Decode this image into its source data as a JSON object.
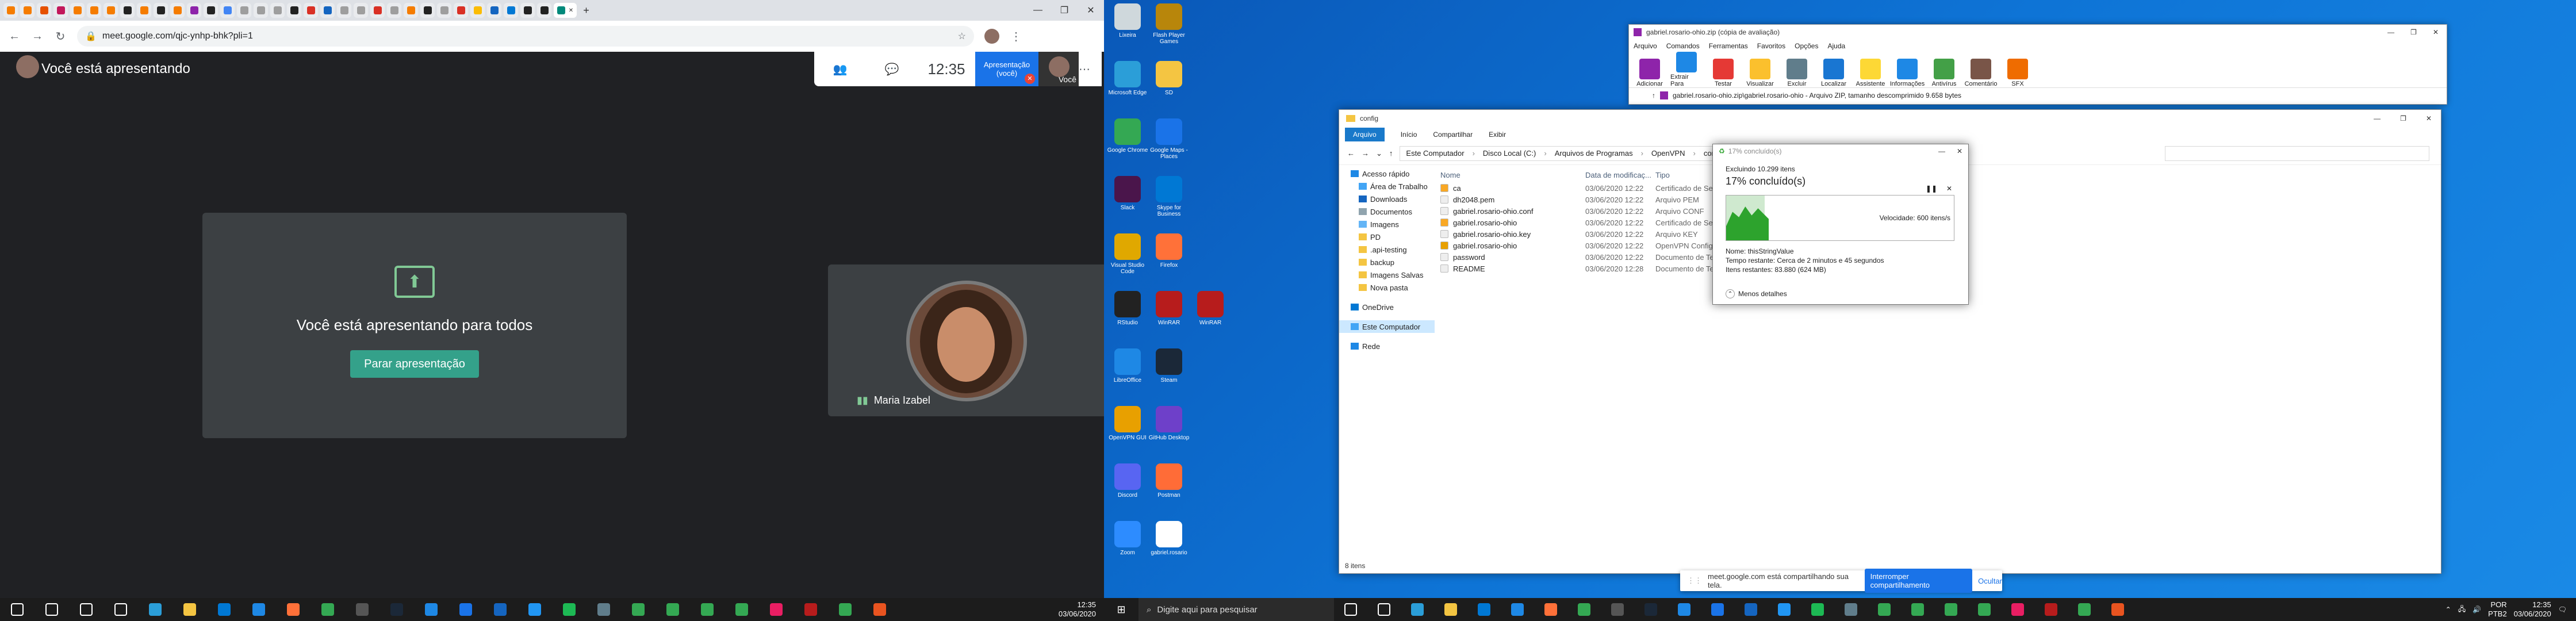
{
  "left": {
    "chrome": {
      "url": "meet.google.com/qjc-ynhp-bhk?pli=1",
      "tabs": [
        {
          "icon": "orange-circle-icon",
          "color": "#f57c00"
        },
        {
          "icon": "orange-circle-icon",
          "color": "#f57c00"
        },
        {
          "icon": "orange-circle-icon",
          "color": "#e65100"
        },
        {
          "icon": "linkedin-icon",
          "color": "#c2185b"
        },
        {
          "icon": "orange-circle-icon",
          "color": "#f57c00"
        },
        {
          "icon": "orange-circle-icon",
          "color": "#f57c00"
        },
        {
          "icon": "orange-circle-icon",
          "color": "#f57c00"
        },
        {
          "icon": "github-icon",
          "color": "#222222"
        },
        {
          "icon": "orange-circle-icon",
          "color": "#f57c00"
        },
        {
          "icon": "github-icon",
          "color": "#222222"
        },
        {
          "icon": "orange-circle-icon",
          "color": "#f57c00"
        },
        {
          "icon": "kanban-icon",
          "color": "#8e24aa"
        },
        {
          "icon": "github-icon",
          "color": "#222222"
        },
        {
          "icon": "google-icon",
          "color": "#4285f4"
        },
        {
          "icon": "page-icon",
          "color": "#9e9e9e"
        },
        {
          "icon": "page-icon",
          "color": "#9e9e9e"
        },
        {
          "icon": "page-icon",
          "color": "#9e9e9e"
        },
        {
          "icon": "github-icon",
          "color": "#222222"
        },
        {
          "icon": "gmail-icon",
          "color": "#d93025"
        },
        {
          "icon": "word-icon",
          "color": "#1565c0"
        },
        {
          "icon": "page-icon",
          "color": "#9e9e9e"
        },
        {
          "icon": "page-icon",
          "color": "#9e9e9e"
        },
        {
          "icon": "gmail-icon",
          "color": "#d93025"
        },
        {
          "icon": "page-icon",
          "color": "#9e9e9e"
        },
        {
          "icon": "orange-circle-icon",
          "color": "#f57c00"
        },
        {
          "icon": "github-icon",
          "color": "#222222"
        },
        {
          "icon": "page-icon",
          "color": "#9e9e9e"
        },
        {
          "icon": "gmail-icon",
          "color": "#d93025"
        },
        {
          "icon": "drive-icon",
          "color": "#fbbc04"
        },
        {
          "icon": "word-icon",
          "color": "#1565c0"
        },
        {
          "icon": "outlook-icon",
          "color": "#0078d4"
        },
        {
          "icon": "github-icon",
          "color": "#222222"
        },
        {
          "icon": "github-icon",
          "color": "#222222"
        },
        {
          "icon": "meet-icon",
          "color": "#00897b",
          "active": true
        }
      ],
      "new_tab": "+",
      "controls": {
        "minimize": "—",
        "maximize": "❐",
        "close": "✕"
      }
    },
    "meet": {
      "presenting_title": "Você está apresentando",
      "clock": "12:35",
      "presentation_tile": "Apresentação\n(você)",
      "you_label": "Você",
      "present_message": "Você está apresentando para todos",
      "stop_button": "Parar apresentação",
      "participant_name": "Maria Izabel"
    },
    "taskbar": {
      "time": "12:35",
      "date": "03/06/2020",
      "apps": [
        {
          "icon": "windows-start-icon",
          "color": "#ffffff"
        },
        {
          "icon": "search-icon",
          "color": "#ffffff"
        },
        {
          "icon": "cortana-icon",
          "color": "#ffffff"
        },
        {
          "icon": "task-view-icon",
          "color": "#ffffff"
        },
        {
          "icon": "edge-icon",
          "color": "#2b9ed8"
        },
        {
          "icon": "file-explorer-icon",
          "color": "#f4c542"
        },
        {
          "icon": "store-icon",
          "color": "#0078d4"
        },
        {
          "icon": "mail-icon",
          "color": "#1e88e5"
        },
        {
          "icon": "firefox-icon",
          "color": "#ff7139"
        },
        {
          "icon": "chrome-icon",
          "color": "#34a853"
        },
        {
          "icon": "terminal-icon",
          "color": "#555555"
        },
        {
          "icon": "steam-icon",
          "color": "#1b2838"
        },
        {
          "icon": "vscode-icon",
          "color": "#1e88e5"
        },
        {
          "icon": "maps-icon",
          "color": "#1a73e8"
        },
        {
          "icon": "snip-icon",
          "color": "#1565c0"
        },
        {
          "icon": "photos-icon",
          "color": "#2196f3"
        },
        {
          "icon": "spotify-icon",
          "color": "#1db954"
        },
        {
          "icon": "app-icon",
          "color": "#607d8b"
        },
        {
          "icon": "chrome-icon",
          "color": "#34a853"
        },
        {
          "icon": "chrome-icon",
          "color": "#34a853"
        },
        {
          "icon": "chrome-icon",
          "color": "#34a853"
        },
        {
          "icon": "chrome-icon",
          "color": "#34a853"
        },
        {
          "icon": "music-icon",
          "color": "#e91e63"
        },
        {
          "icon": "winrar-icon",
          "color": "#b71c1c"
        },
        {
          "icon": "chrome-icon",
          "color": "#34a853"
        },
        {
          "icon": "ubuntu-icon",
          "color": "#e95420"
        }
      ]
    }
  },
  "right": {
    "desktop_icons": [
      {
        "label": "Lixeira",
        "color": "#cfd8dc",
        "col": 0,
        "row": 0
      },
      {
        "label": "Flash Player Games",
        "color": "#b8860b",
        "col": 1,
        "row": 0
      },
      {
        "label": "Microsoft Edge",
        "color": "#2b9ed8",
        "col": 0,
        "row": 1
      },
      {
        "label": "SD",
        "color": "#f4c542",
        "col": 1,
        "row": 1
      },
      {
        "label": "Google Chrome",
        "color": "#34a853",
        "col": 0,
        "row": 2
      },
      {
        "label": "Google Maps - Places",
        "color": "#1a73e8",
        "col": 1,
        "row": 2
      },
      {
        "label": "Slack",
        "color": "#4a154b",
        "col": 0,
        "row": 3
      },
      {
        "label": "Skype for Business",
        "color": "#0078d4",
        "col": 1,
        "row": 3
      },
      {
        "label": "Visual Studio Code",
        "color": "#e0a800",
        "col": 0,
        "row": 4
      },
      {
        "label": "Firefox",
        "color": "#ff7139",
        "col": 1,
        "row": 4
      },
      {
        "label": "RStudio",
        "color": "#222222",
        "col": 0,
        "row": 5
      },
      {
        "label": "WinRAR",
        "color": "#b71c1c",
        "col": 1,
        "row": 5
      },
      {
        "label": "WinRAR",
        "color": "#b71c1c",
        "col": 2,
        "row": 5
      },
      {
        "label": "Steam",
        "color": "#1b2838",
        "col": 1,
        "row": 6
      },
      {
        "label": "LibreOffice",
        "color": "#1e88e5",
        "col": 0,
        "row": 6
      },
      {
        "label": "OpenVPN GUI",
        "color": "#e8a000",
        "col": 0,
        "row": 7
      },
      {
        "label": "GitHub Desktop",
        "color": "#6e40c9",
        "col": 1,
        "row": 7
      },
      {
        "label": "Discord",
        "color": "#5865f2",
        "col": 0,
        "row": 8
      },
      {
        "label": "Postman",
        "color": "#ff6c37",
        "col": 1,
        "row": 8
      },
      {
        "label": "Zoom",
        "color": "#2d8cff",
        "col": 0,
        "row": 9
      },
      {
        "label": "gabriel.rosario",
        "color": "#ffffff",
        "col": 1,
        "row": 9
      }
    ],
    "winrar": {
      "title": "gabriel.rosario-ohio.zip (cópia de avaliação)",
      "menu": [
        "Arquivo",
        "Comandos",
        "Ferramentas",
        "Favoritos",
        "Opções",
        "Ajuda"
      ],
      "tools": [
        {
          "label": "Adicionar",
          "color": "#8e24aa"
        },
        {
          "label": "Extrair Para",
          "color": "#1e88e5"
        },
        {
          "label": "Testar",
          "color": "#e53935"
        },
        {
          "label": "Visualizar",
          "color": "#fbc02d"
        },
        {
          "label": "Excluir",
          "color": "#607d8b"
        },
        {
          "label": "Localizar",
          "color": "#1976d2"
        },
        {
          "label": "Assistente",
          "color": "#fdd835"
        },
        {
          "label": "Informações",
          "color": "#1e88e5"
        },
        {
          "label": "Antivírus",
          "color": "#43a047"
        },
        {
          "label": "Comentário",
          "color": "#795548"
        },
        {
          "label": "SFX",
          "color": "#ef6c00"
        }
      ],
      "address": "gabriel.rosario-ohio.zip\\gabriel.rosario-ohio - Arquivo ZIP, tamanho descomprimido 9.658 bytes"
    },
    "explorer": {
      "title": "config",
      "ribbon": [
        "Arquivo",
        "Início",
        "Compartilhar",
        "Exibir"
      ],
      "breadcrumb": [
        "Este Computador",
        "Disco Local (C:)",
        "Arquivos de Programas",
        "OpenVPN",
        "config"
      ],
      "nav": [
        {
          "label": "Acesso rápido",
          "color": "#1e88e5",
          "indent": 0
        },
        {
          "label": "Área de Trabalho",
          "color": "#42a5f5",
          "indent": 1
        },
        {
          "label": "Downloads",
          "color": "#1565c0",
          "indent": 1
        },
        {
          "label": "Documentos",
          "color": "#90a4ae",
          "indent": 1
        },
        {
          "label": "Imagens",
          "color": "#64b5f6",
          "indent": 1
        },
        {
          "label": "PD",
          "color": "#f4c542",
          "indent": 1
        },
        {
          "label": ".api-testing",
          "color": "#f4c542",
          "indent": 1
        },
        {
          "label": "backup",
          "color": "#f4c542",
          "indent": 1
        },
        {
          "label": "Imagens Salvas",
          "color": "#f4c542",
          "indent": 1
        },
        {
          "label": "Nova pasta",
          "color": "#f4c542",
          "indent": 1
        },
        {
          "label": "OneDrive",
          "color": "#0078d4",
          "indent": 0
        },
        {
          "label": "Este Computador",
          "color": "#42a5f5",
          "indent": 0,
          "selected": true
        },
        {
          "label": "Rede",
          "color": "#1e88e5",
          "indent": 0
        }
      ],
      "columns": {
        "name": "Nome",
        "date": "Data de modificaç...",
        "type": "Tipo"
      },
      "files": [
        {
          "name": "ca",
          "date": "03/06/2020 12:22",
          "type": "Certificado de Se...",
          "color": "#f9a825"
        },
        {
          "name": "dh2048.pem",
          "date": "03/06/2020 12:22",
          "type": "Arquivo PEM",
          "color": "#eeeeee"
        },
        {
          "name": "gabriel.rosario-ohio.conf",
          "date": "03/06/2020 12:22",
          "type": "Arquivo CONF",
          "color": "#eeeeee"
        },
        {
          "name": "gabriel.rosario-ohio",
          "date": "03/06/2020 12:22",
          "type": "Certificado de Se...",
          "color": "#f9a825"
        },
        {
          "name": "gabriel.rosario-ohio.key",
          "date": "03/06/2020 12:22",
          "type": "Arquivo KEY",
          "color": "#eeeeee"
        },
        {
          "name": "gabriel.rosario-ohio",
          "date": "03/06/2020 12:22",
          "type": "OpenVPN Config",
          "color": "#e8a000"
        },
        {
          "name": "password",
          "date": "03/06/2020 12:22",
          "type": "Documento de Te...",
          "color": "#eeeeee"
        },
        {
          "name": "README",
          "date": "03/06/2020 12:28",
          "type": "Documento de Te...",
          "color": "#eeeeee"
        }
      ],
      "status": "8 itens"
    },
    "progress": {
      "title": "17% concluído(s)",
      "line1": "Excluindo 10.299 itens",
      "percent_text": "17% concluído(s)",
      "percent": 0.17,
      "speed": "Velocidade: 600 itens/s",
      "name": "Nome: thisStringValue",
      "time": "Tempo restante: Cerca de 2 minutos e 45 segundos",
      "remaining": "Itens restantes: 83.880 (624 MB)",
      "less": "Menos detalhes"
    },
    "sharebar": {
      "text": "meet.google.com está compartilhando sua tela.",
      "stop": "Interromper compartilhamento",
      "hide": "Ocultar"
    },
    "taskbar": {
      "search_placeholder": "Digite aqui para pesquisar",
      "time": "12:35",
      "date": "03/06/2020",
      "lang": "POR",
      "lang2": "PTB2",
      "apps": [
        {
          "icon": "cortana-icon",
          "color": "#ffffff"
        },
        {
          "icon": "task-view-icon",
          "color": "#ffffff"
        },
        {
          "icon": "edge-icon",
          "color": "#2b9ed8"
        },
        {
          "icon": "file-explorer-icon",
          "color": "#f4c542"
        },
        {
          "icon": "store-icon",
          "color": "#0078d4"
        },
        {
          "icon": "mail-icon",
          "color": "#1e88e5"
        },
        {
          "icon": "firefox-icon",
          "color": "#ff7139"
        },
        {
          "icon": "chrome-icon",
          "color": "#34a853"
        },
        {
          "icon": "terminal-icon",
          "color": "#555555"
        },
        {
          "icon": "steam-icon",
          "color": "#1b2838"
        },
        {
          "icon": "vscode-icon",
          "color": "#1e88e5"
        },
        {
          "icon": "maps-icon",
          "color": "#1a73e8"
        },
        {
          "icon": "snip-icon",
          "color": "#1565c0"
        },
        {
          "icon": "photos-icon",
          "color": "#2196f3"
        },
        {
          "icon": "spotify-icon",
          "color": "#1db954"
        },
        {
          "icon": "app-icon",
          "color": "#607d8b"
        },
        {
          "icon": "chrome-icon",
          "color": "#34a853"
        },
        {
          "icon": "chrome-icon",
          "color": "#34a853"
        },
        {
          "icon": "chrome-icon",
          "color": "#34a853"
        },
        {
          "icon": "chrome-icon",
          "color": "#34a853"
        },
        {
          "icon": "music-icon",
          "color": "#e91e63"
        },
        {
          "icon": "winrar-icon",
          "color": "#b71c1c"
        },
        {
          "icon": "chrome-icon",
          "color": "#34a853"
        },
        {
          "icon": "ubuntu-icon",
          "color": "#e95420"
        }
      ]
    }
  }
}
